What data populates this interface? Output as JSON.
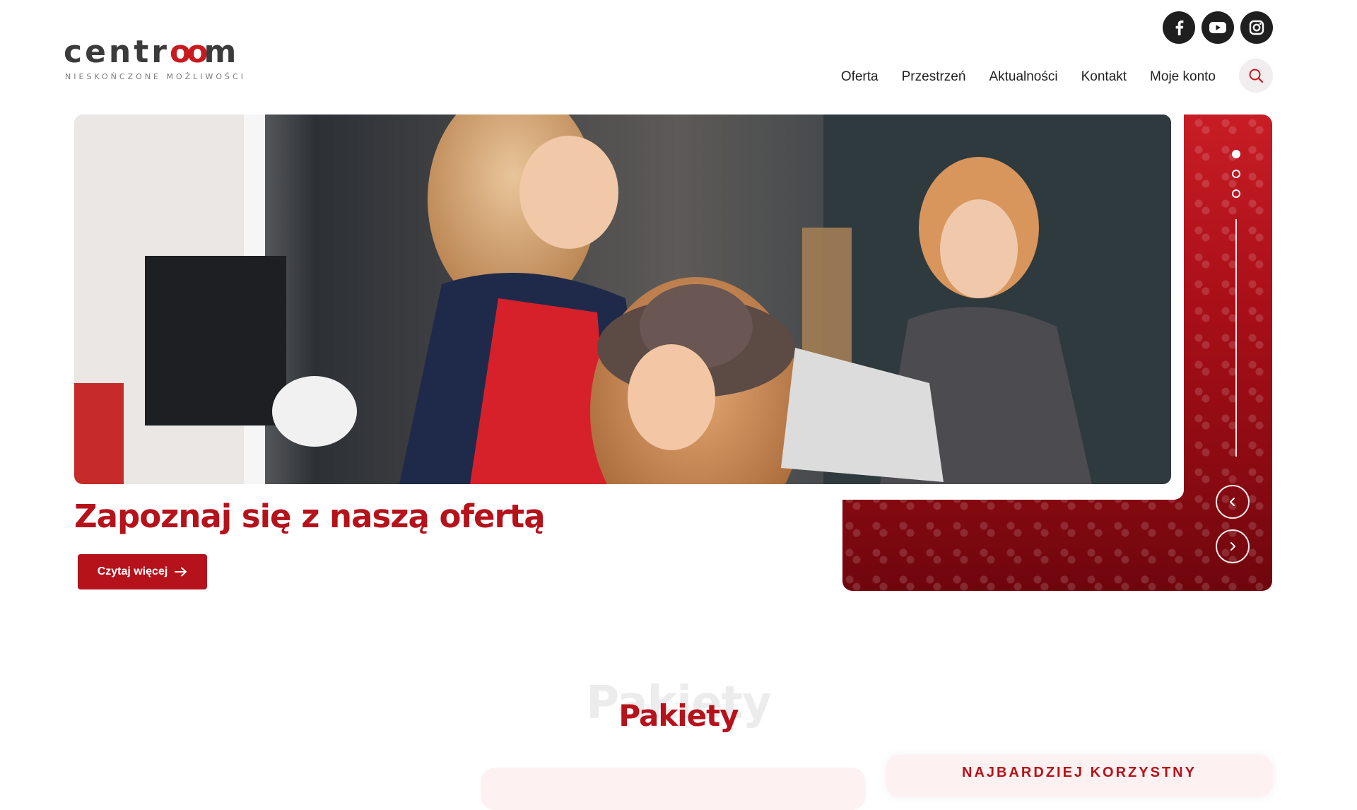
{
  "brand": {
    "logo_text": "centr",
    "logo_infinity": "oo",
    "logo_end": "m",
    "tagline": "NIESKOŃCZONE MOŻLIWOŚCI"
  },
  "social": [
    {
      "name": "facebook-icon"
    },
    {
      "name": "youtube-icon"
    },
    {
      "name": "instagram-icon"
    }
  ],
  "nav": {
    "items": [
      "Oferta",
      "Przestrzeń",
      "Aktualności",
      "Kontakt",
      "Moje konto"
    ]
  },
  "hero": {
    "title": "Zapoznaj się z naszą ofertą",
    "cta_label": "Czytaj więcej",
    "slides_total": 3,
    "active_slide": 1
  },
  "section": {
    "ghost_title": "Pakiety",
    "title": "Pakiety",
    "featured_label": "NAJBARDZIEJ KORZYSTNY"
  },
  "colors": {
    "brand_red": "#b5121b",
    "dark": "#1f1f1f"
  }
}
